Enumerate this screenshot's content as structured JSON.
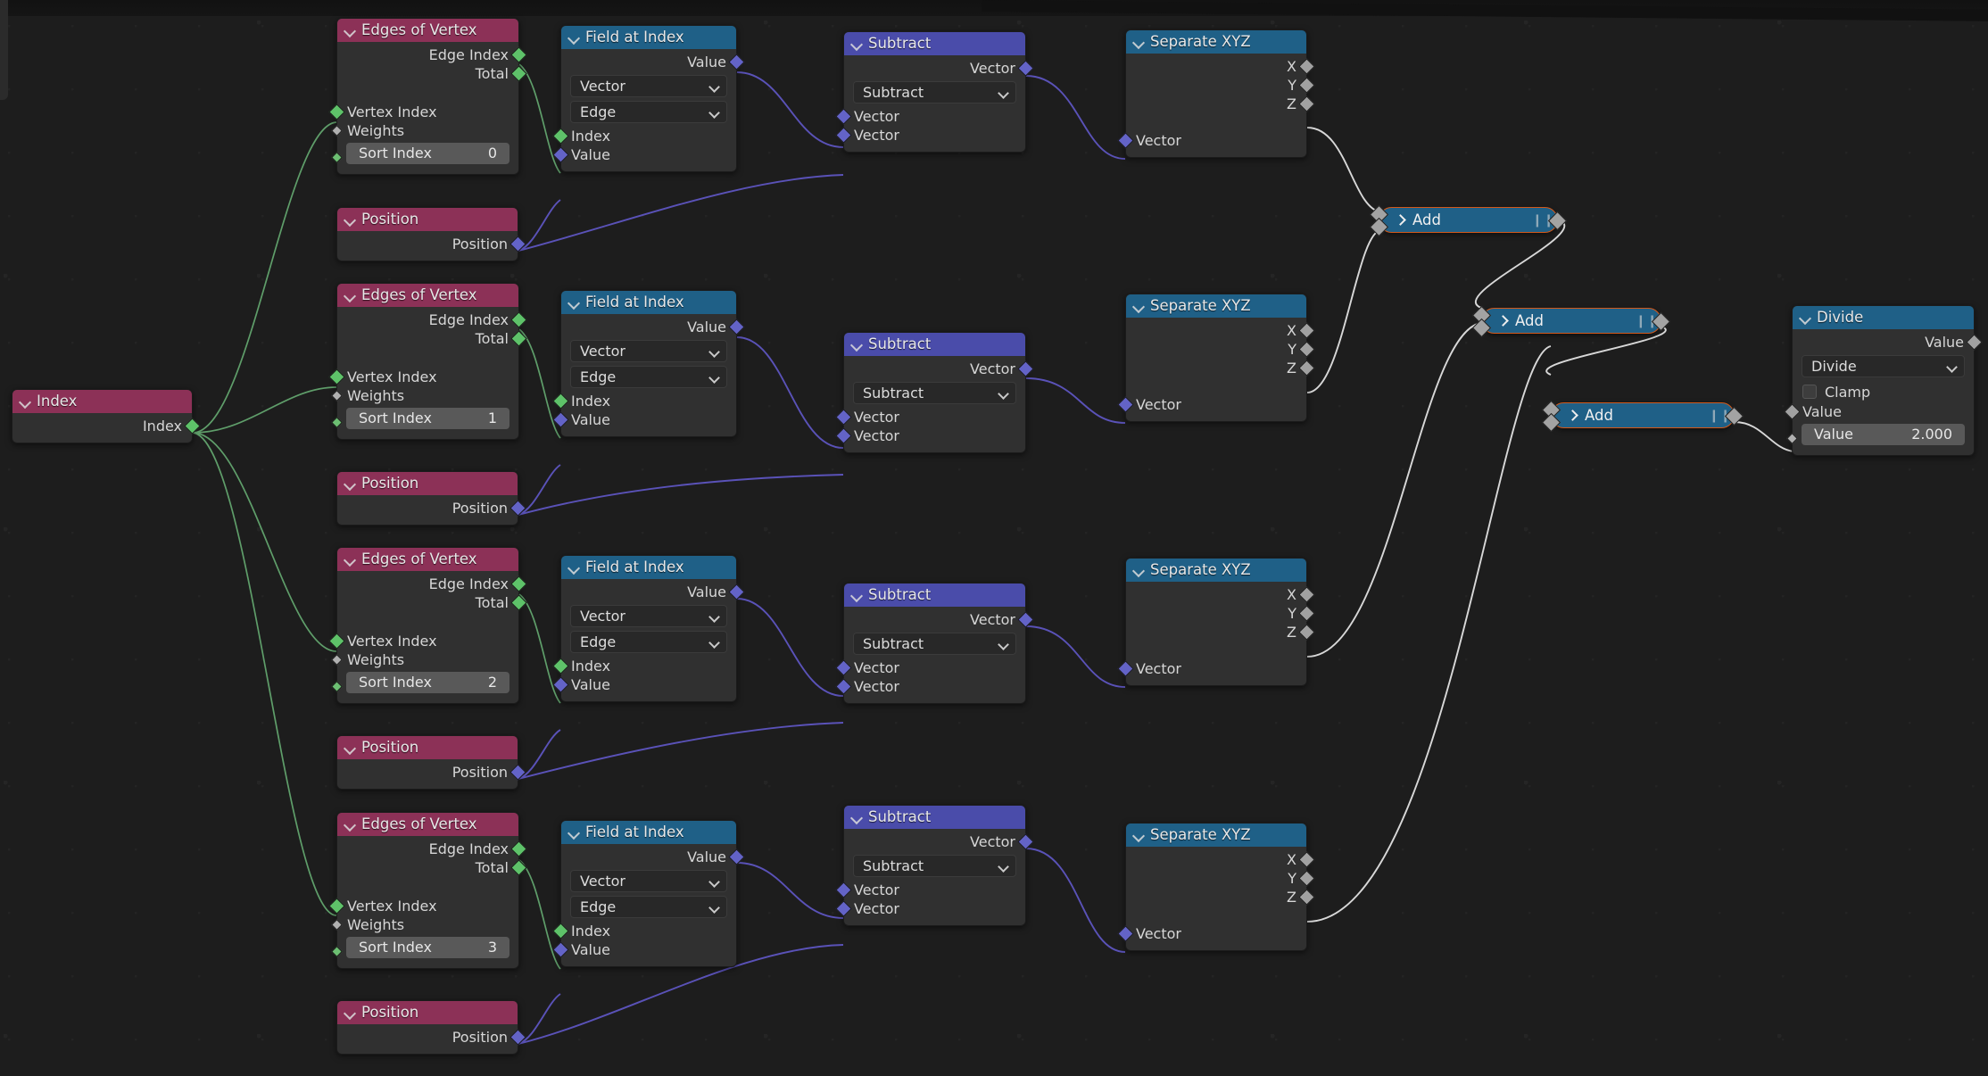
{
  "app": {
    "editor": "Geometry Node Editor"
  },
  "colors": {
    "canvas": "#1d1d1d",
    "node_body": "#303030",
    "header_input": "#8c3157",
    "header_utility": "#1f6087",
    "header_vector": "#4a4caa",
    "selection_outline": "#d1581a",
    "socket_int": "#5ec269",
    "socket_vector": "#6363c7",
    "socket_float": "#a1a1a1",
    "wire_grey": "#d8d8d8"
  },
  "labels": {
    "value": "Value",
    "vector": "Vector",
    "index": "Index",
    "edge": "Edge",
    "position": "Position",
    "total": "Total",
    "edge_index": "Edge Index",
    "vertex_index": "Vertex Index",
    "weights": "Weights",
    "sort_index": "Sort Index",
    "clamp": "Clamp",
    "x": "X",
    "y": "Y",
    "z": "Z"
  },
  "nodes": {
    "index": {
      "title": "Index",
      "category": "input",
      "outputs": [
        {
          "label": "Index",
          "type": "int"
        }
      ]
    },
    "edges_of_vertex": [
      {
        "title": "Edges of Vertex",
        "category": "input",
        "outputs": [
          {
            "label": "Edge Index",
            "type": "int"
          },
          {
            "label": "Total",
            "type": "int"
          }
        ],
        "inputs": [
          {
            "label": "Vertex Index",
            "type": "int"
          },
          {
            "label": "Weights",
            "type": "float"
          }
        ],
        "sort_index_label": "Sort Index",
        "sort_index_value": "0"
      },
      {
        "title": "Edges of Vertex",
        "category": "input",
        "outputs": [
          {
            "label": "Edge Index",
            "type": "int"
          },
          {
            "label": "Total",
            "type": "int"
          }
        ],
        "inputs": [
          {
            "label": "Vertex Index",
            "type": "int"
          },
          {
            "label": "Weights",
            "type": "float"
          }
        ],
        "sort_index_label": "Sort Index",
        "sort_index_value": "1"
      },
      {
        "title": "Edges of Vertex",
        "category": "input",
        "outputs": [
          {
            "label": "Edge Index",
            "type": "int"
          },
          {
            "label": "Total",
            "type": "int"
          }
        ],
        "inputs": [
          {
            "label": "Vertex Index",
            "type": "int"
          },
          {
            "label": "Weights",
            "type": "float"
          }
        ],
        "sort_index_label": "Sort Index",
        "sort_index_value": "2"
      },
      {
        "title": "Edges of Vertex",
        "category": "input",
        "outputs": [
          {
            "label": "Edge Index",
            "type": "int"
          },
          {
            "label": "Total",
            "type": "int"
          }
        ],
        "inputs": [
          {
            "label": "Vertex Index",
            "type": "int"
          },
          {
            "label": "Weights",
            "type": "float"
          }
        ],
        "sort_index_label": "Sort Index",
        "sort_index_value": "3"
      }
    ],
    "position": [
      {
        "title": "Position",
        "category": "input",
        "outputs": [
          {
            "label": "Position",
            "type": "vector"
          }
        ]
      },
      {
        "title": "Position",
        "category": "input",
        "outputs": [
          {
            "label": "Position",
            "type": "vector"
          }
        ]
      },
      {
        "title": "Position",
        "category": "input",
        "outputs": [
          {
            "label": "Position",
            "type": "vector"
          }
        ]
      },
      {
        "title": "Position",
        "category": "input",
        "outputs": [
          {
            "label": "Position",
            "type": "vector"
          }
        ]
      }
    ],
    "field_at_index": [
      {
        "title": "Field at Index",
        "category": "utility",
        "output_label": "Value",
        "data_type": "Vector",
        "domain": "Edge",
        "inputs": [
          {
            "label": "Index",
            "type": "int"
          },
          {
            "label": "Value",
            "type": "vector"
          }
        ]
      },
      {
        "title": "Field at Index",
        "category": "utility",
        "output_label": "Value",
        "data_type": "Vector",
        "domain": "Edge",
        "inputs": [
          {
            "label": "Index",
            "type": "int"
          },
          {
            "label": "Value",
            "type": "vector"
          }
        ]
      },
      {
        "title": "Field at Index",
        "category": "utility",
        "output_label": "Value",
        "data_type": "Vector",
        "domain": "Edge",
        "inputs": [
          {
            "label": "Index",
            "type": "int"
          },
          {
            "label": "Value",
            "type": "vector"
          }
        ]
      },
      {
        "title": "Field at Index",
        "category": "utility",
        "output_label": "Value",
        "data_type": "Vector",
        "domain": "Edge",
        "inputs": [
          {
            "label": "Index",
            "type": "int"
          },
          {
            "label": "Value",
            "type": "vector"
          }
        ]
      }
    ],
    "subtract": [
      {
        "title": "Subtract",
        "category": "vector",
        "output_label": "Vector",
        "operation": "Subtract",
        "inputs": [
          {
            "label": "Vector",
            "type": "vector"
          },
          {
            "label": "Vector",
            "type": "vector"
          }
        ]
      },
      {
        "title": "Subtract",
        "category": "vector",
        "output_label": "Vector",
        "operation": "Subtract",
        "inputs": [
          {
            "label": "Vector",
            "type": "vector"
          },
          {
            "label": "Vector",
            "type": "vector"
          }
        ]
      },
      {
        "title": "Subtract",
        "category": "vector",
        "output_label": "Vector",
        "operation": "Subtract",
        "inputs": [
          {
            "label": "Vector",
            "type": "vector"
          },
          {
            "label": "Vector",
            "type": "vector"
          }
        ]
      },
      {
        "title": "Subtract",
        "category": "vector",
        "output_label": "Vector",
        "operation": "Subtract",
        "inputs": [
          {
            "label": "Vector",
            "type": "vector"
          },
          {
            "label": "Vector",
            "type": "vector"
          }
        ]
      }
    ],
    "separate_xyz": [
      {
        "title": "Separate XYZ",
        "category": "utility",
        "outputs": [
          {
            "label": "X",
            "type": "float"
          },
          {
            "label": "Y",
            "type": "float"
          },
          {
            "label": "Z",
            "type": "float"
          }
        ],
        "inputs": [
          {
            "label": "Vector",
            "type": "vector"
          }
        ]
      },
      {
        "title": "Separate XYZ",
        "category": "utility",
        "outputs": [
          {
            "label": "X",
            "type": "float"
          },
          {
            "label": "Y",
            "type": "float"
          },
          {
            "label": "Z",
            "type": "float"
          }
        ],
        "inputs": [
          {
            "label": "Vector",
            "type": "vector"
          }
        ]
      },
      {
        "title": "Separate XYZ",
        "category": "utility",
        "outputs": [
          {
            "label": "X",
            "type": "float"
          },
          {
            "label": "Y",
            "type": "float"
          },
          {
            "label": "Z",
            "type": "float"
          }
        ],
        "inputs": [
          {
            "label": "Vector",
            "type": "vector"
          }
        ]
      },
      {
        "title": "Separate XYZ",
        "category": "utility",
        "outputs": [
          {
            "label": "X",
            "type": "float"
          },
          {
            "label": "Y",
            "type": "float"
          },
          {
            "label": "Z",
            "type": "float"
          }
        ],
        "inputs": [
          {
            "label": "Vector",
            "type": "vector"
          }
        ]
      }
    ],
    "add": [
      {
        "title": "Add",
        "category": "utility",
        "collapsed": true,
        "selected": true
      },
      {
        "title": "Add",
        "category": "utility",
        "collapsed": true,
        "selected": true
      },
      {
        "title": "Add",
        "category": "utility",
        "collapsed": true,
        "selected": true
      }
    ],
    "divide": {
      "title": "Divide",
      "category": "utility",
      "output_label": "Value",
      "operation": "Divide",
      "clamp_label": "Clamp",
      "clamp_checked": false,
      "input_label": "Value",
      "value_label": "Value",
      "value": "2.000"
    }
  }
}
